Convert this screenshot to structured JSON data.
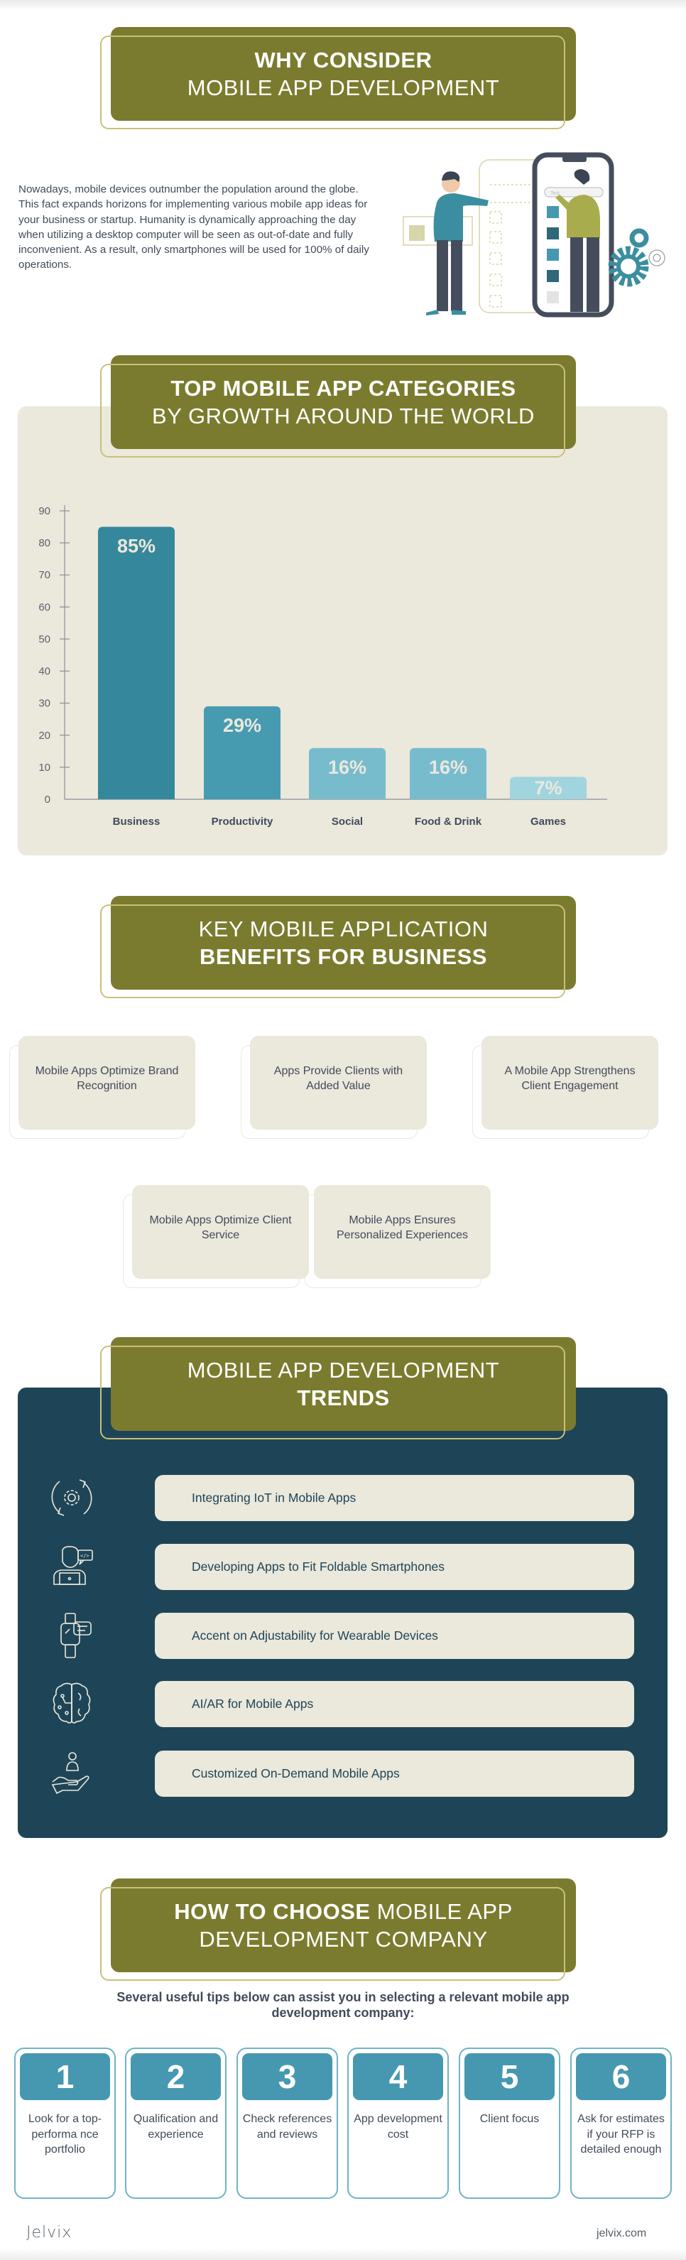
{
  "sections": {
    "why": {
      "title_bold": "WHY CONSIDER",
      "title_light": "MOBILE APP DEVELOPMENT",
      "body": "Nowadays, mobile devices outnumber the population around the globe. This fact expands horizons for implementing various mobile app ideas for your business or startup. Humanity is dynamically approaching the day when utilizing a desktop computer will be seen as out-of-date and fully inconvenient. As a result, only smartphones will be used for 100% of daily operations.",
      "illustration": {
        "search_placeholder": "Text",
        "icon": "people-building-mobile-app-illustration"
      }
    },
    "categories": {
      "title_bold": "TOP MOBILE APP CATEGORIES",
      "title_light": "BY GROWTH AROUND THE WORLD"
    },
    "benefits": {
      "title_light": "KEY MOBILE APPLICATION",
      "title_bold": "BENEFITS FOR BUSINESS",
      "items": [
        "Mobile Apps Optimize Brand Recognition",
        "Apps Provide Clients with Added Value",
        "A Mobile App Strengthens Client Engagement",
        "Mobile Apps Optimize Client Service",
        "Mobile Apps Ensures Personalized Experiences"
      ]
    },
    "trends": {
      "title_light": "MOBILE APP DEVELOPMENT",
      "title_bold": "TRENDS",
      "items": [
        {
          "label": "Integrating IoT in Mobile Apps",
          "icon": "gear-cycle-icon"
        },
        {
          "label": "Developing Apps to Fit Foldable Smartphones",
          "icon": "developer-laptop-icon"
        },
        {
          "label": "Accent on Adjustability for Wearable Devices",
          "icon": "smartwatch-icon"
        },
        {
          "label": "AI/AR for Mobile Apps",
          "icon": "ai-brain-icon"
        },
        {
          "label": "Customized On-Demand Mobile Apps",
          "icon": "hand-user-icon"
        }
      ]
    },
    "choose": {
      "title_bold": "HOW TO CHOOSE",
      "title_light_1": "MOBILE APP",
      "title_light_2": "DEVELOPMENT COMPANY",
      "intro": "Several useful tips below can assist you in selecting a relevant mobile app development company:",
      "tips": [
        {
          "num": "1",
          "text": "Look for a top-performa nce portfolio"
        },
        {
          "num": "2",
          "text": "Qualification and experience"
        },
        {
          "num": "3",
          "text": "Check references and reviews"
        },
        {
          "num": "4",
          "text": "App development cost"
        },
        {
          "num": "5",
          "text": "Client focus"
        },
        {
          "num": "6",
          "text": "Ask for estimates if your RFP is detailed enough"
        }
      ]
    }
  },
  "footer": {
    "logo": "Jelvix",
    "url": "jelvix.com"
  },
  "colors": {
    "olive": "#7b7b2f",
    "cream": "#ebe8dc",
    "navy": "#1e4557",
    "teal": "#4698b0",
    "text": "#414b5a"
  },
  "chart_data": {
    "type": "bar",
    "title": "TOP MOBILE APP CATEGORIES BY GROWTH AROUND THE WORLD",
    "xlabel": "",
    "ylabel": "",
    "categories": [
      "Business",
      "Productivity",
      "Social",
      "Food & Drink",
      "Games"
    ],
    "values": [
      85,
      29,
      16,
      16,
      7
    ],
    "value_labels": [
      "85%",
      "29%",
      "16%",
      "16%",
      "7%"
    ],
    "bar_colors": [
      "#35889b",
      "#479bb1",
      "#77bccd",
      "#77bccd",
      "#a0d5e0"
    ],
    "yticks": [
      0,
      10,
      20,
      30,
      40,
      50,
      60,
      70,
      80,
      90
    ],
    "ylim": [
      0,
      90
    ],
    "grid": false,
    "legend": "none"
  }
}
